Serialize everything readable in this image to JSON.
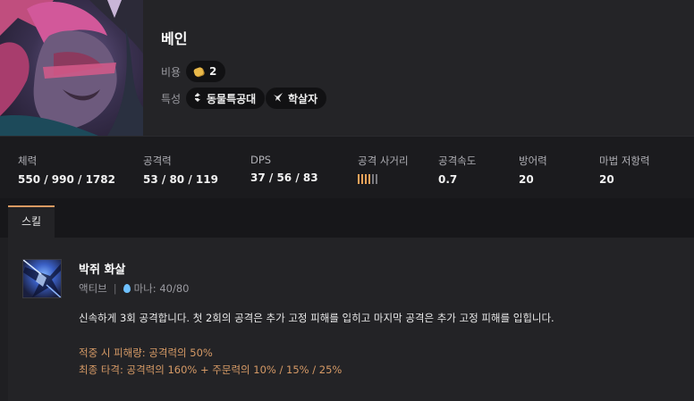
{
  "champion": {
    "name": "베인",
    "cost_label": "비용",
    "cost_value": "2",
    "trait_label": "특성",
    "traits": [
      {
        "name": "동물특공대",
        "icon": "trait-animal-squad-icon"
      },
      {
        "name": "학살자",
        "icon": "trait-slayer-icon"
      }
    ]
  },
  "stats": [
    {
      "label": "체력",
      "value": "550 / 990 / 1782"
    },
    {
      "label": "공격력",
      "value": "53 / 80 / 119"
    },
    {
      "label": "DPS",
      "value": "37 / 56 / 83"
    },
    {
      "label": "공격 사거리",
      "range_level": 4,
      "range_max": 6
    },
    {
      "label": "공격속도",
      "value": "0.7"
    },
    {
      "label": "방어력",
      "value": "20"
    },
    {
      "label": "마법 저항력",
      "value": "20"
    }
  ],
  "tabs": [
    {
      "label": "스킬",
      "active": true
    }
  ],
  "skill": {
    "name": "박쥐 화살",
    "type": "액티브",
    "separator": "|",
    "mana": "마나: 40/80",
    "description": "신속하게 3회 공격합니다. 첫 2회의 공격은 추가 고정 피해를 입히고 마지막 공격은 추가 고정 피해를 입힙니다.",
    "detail_lines": [
      "적중 시 피해량: 공격력의 50%",
      "최종 타격: 공격력의 160% + 주문력의 10% / 15% / 25%"
    ]
  },
  "colors": {
    "accent": "#d99a62",
    "coin": "#e8b84a",
    "mana": "#6fc1ff",
    "background": "#1f1f22"
  }
}
